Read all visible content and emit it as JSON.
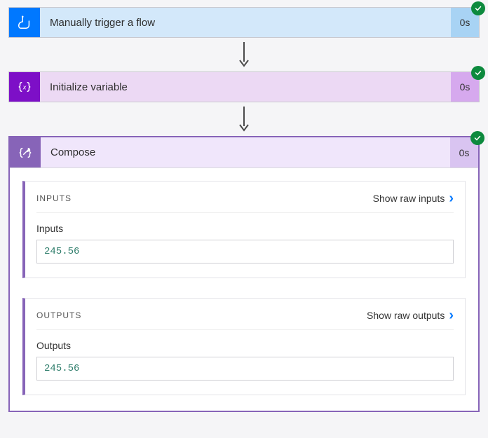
{
  "steps": {
    "trigger": {
      "title": "Manually trigger a flow",
      "timing": "0s"
    },
    "init": {
      "title": "Initialize variable",
      "timing": "0s"
    },
    "compose": {
      "title": "Compose",
      "timing": "0s"
    }
  },
  "compose_detail": {
    "inputs_section": {
      "header": "INPUTS",
      "show_raw_label": "Show raw inputs",
      "field_label": "Inputs",
      "value": "245.56"
    },
    "outputs_section": {
      "header": "OUTPUTS",
      "show_raw_label": "Show raw outputs",
      "field_label": "Outputs",
      "value": "245.56"
    }
  }
}
